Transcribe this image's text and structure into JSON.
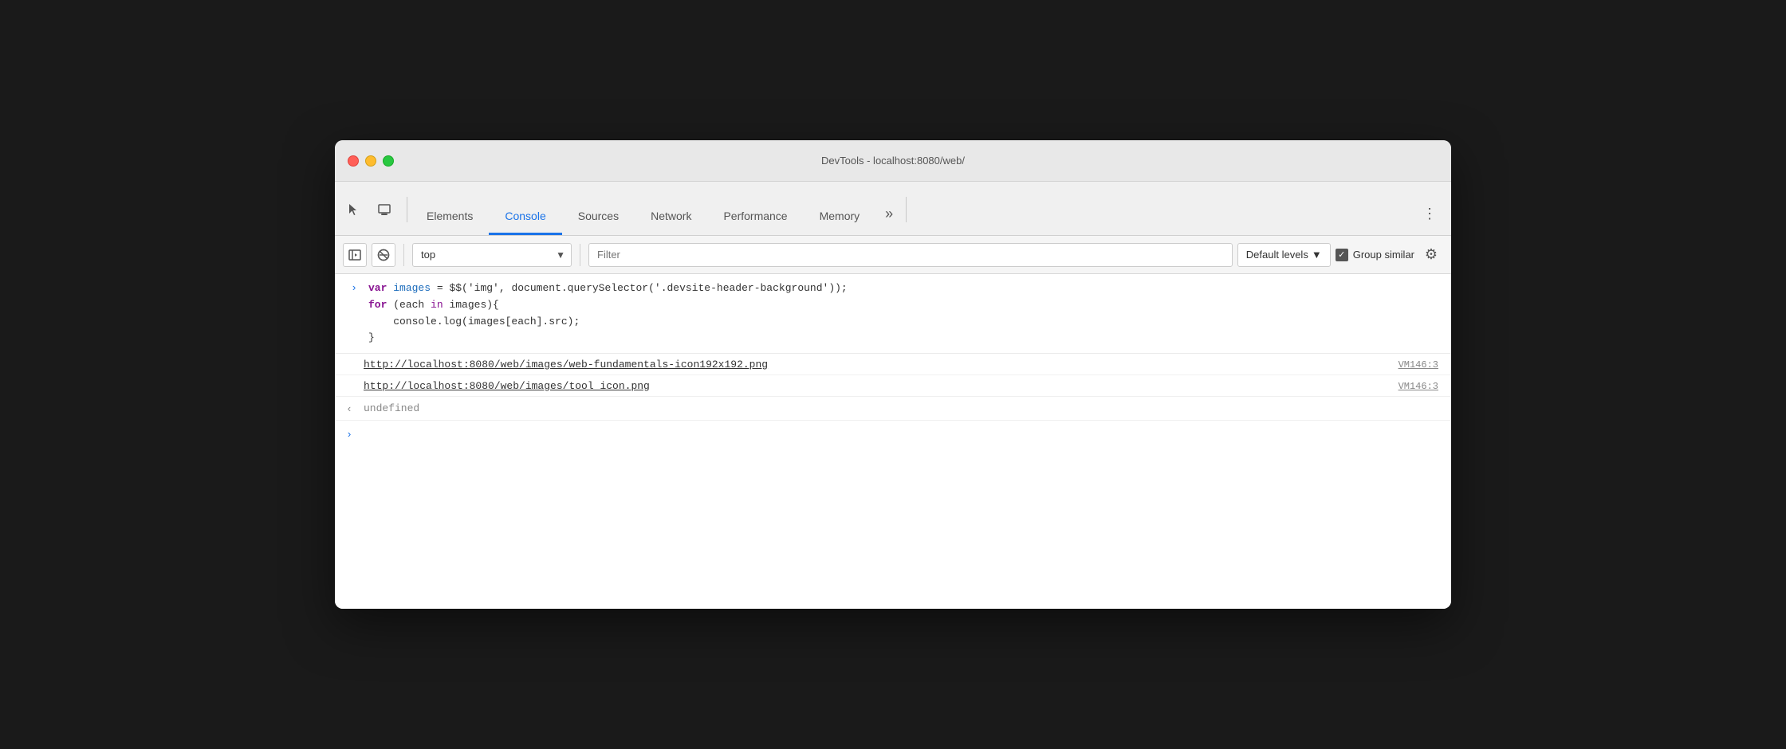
{
  "window": {
    "title": "DevTools - localhost:8080/web/"
  },
  "tabs": [
    {
      "id": "elements",
      "label": "Elements",
      "active": false
    },
    {
      "id": "console",
      "label": "Console",
      "active": true
    },
    {
      "id": "sources",
      "label": "Sources",
      "active": false
    },
    {
      "id": "network",
      "label": "Network",
      "active": false
    },
    {
      "id": "performance",
      "label": "Performance",
      "active": false
    },
    {
      "id": "memory",
      "label": "Memory",
      "active": false
    }
  ],
  "toolbar": {
    "context_value": "top",
    "context_placeholder": "top",
    "filter_placeholder": "Filter",
    "levels_label": "Default levels",
    "group_similar_label": "Group similar"
  },
  "console_entries": [
    {
      "type": "code",
      "arrow": ">",
      "code_lines": [
        "var images = $$('img', document.querySelector('.devsite-header-background'));",
        "for (each in images){",
        "    console.log(images[each].src);",
        "}"
      ]
    },
    {
      "type": "link",
      "url": "http://localhost:8080/web/images/web-fundamentals-icon192x192.png",
      "source": "VM146:3"
    },
    {
      "type": "link",
      "url": "http://localhost:8080/web/images/tool_icon.png",
      "source": "VM146:3"
    },
    {
      "type": "undefined",
      "arrow": "<",
      "text": "undefined"
    }
  ],
  "icons": {
    "cursor": "⬆",
    "device": "⬛",
    "more_tabs": "»",
    "menu": "⋮",
    "sidebar": "▶",
    "block": "⊘",
    "chevron_down": "▼",
    "checkbox_check": "✓",
    "gear": "⚙"
  }
}
